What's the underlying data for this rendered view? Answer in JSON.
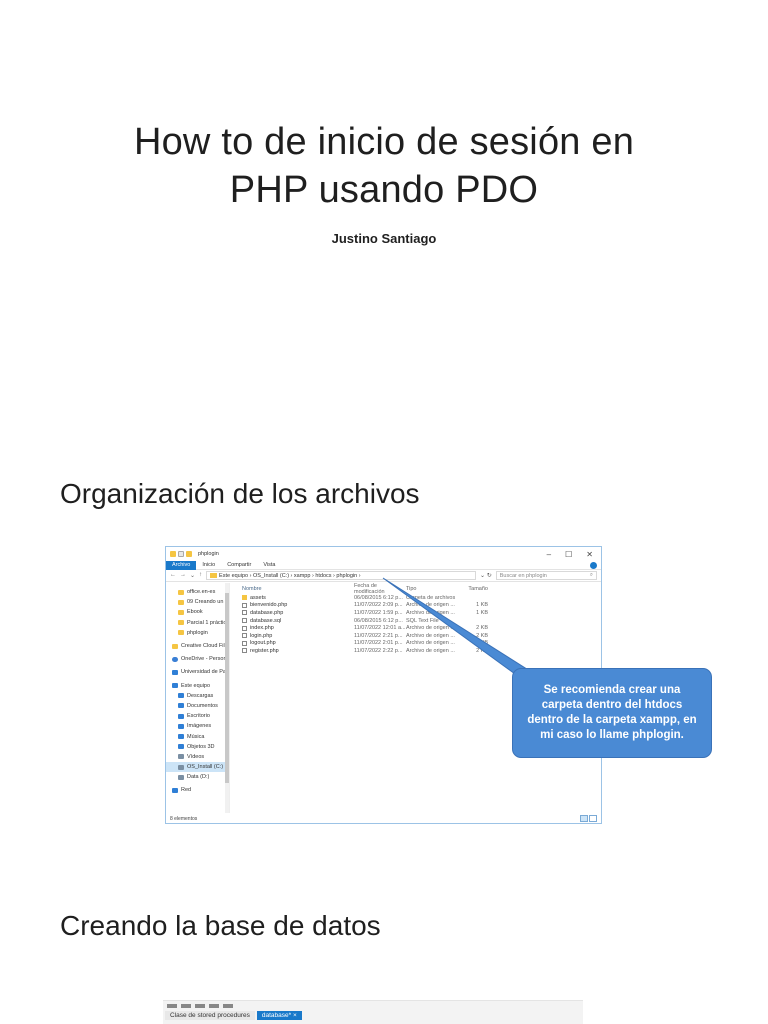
{
  "slide": {
    "title_line1": "How to de inicio de sesión en",
    "title_line2": "PHP usando PDO",
    "author": "Justino Santiago",
    "section1": "Organización de los archivos",
    "section2": "Creando la base de datos"
  },
  "explorer": {
    "window_title": "phplogin",
    "window_controls": [
      "–",
      "☐",
      "✕"
    ],
    "ribbon_tabs": [
      "Archivo",
      "Inicio",
      "Compartir",
      "Vista"
    ],
    "nav_arrows": [
      "←",
      "→",
      "⌄",
      "↑"
    ],
    "breadcrumb": "Este equipo  ›  OS_Install (C:)  ›  xampp  ›  htdocs  ›  phplogin  ›",
    "search_placeholder": "Buscar en phplogin",
    "columns": [
      "Nombre",
      "Fecha de modificación",
      "Tipo",
      "Tamaño"
    ],
    "nav_items": [
      {
        "label": "office.en-es",
        "icon": "folder",
        "indent": true
      },
      {
        "label": "09 Creando un lo",
        "icon": "folder",
        "indent": true
      },
      {
        "label": "Ebook",
        "icon": "folder",
        "indent": true
      },
      {
        "label": "Parcial 1 práctico",
        "icon": "folder",
        "indent": true
      },
      {
        "label": "phplogin",
        "icon": "folder",
        "indent": true
      },
      {
        "label": "Creative Cloud Fil",
        "icon": "folder",
        "indent": false,
        "gap": true
      },
      {
        "label": "OneDrive - Person",
        "icon": "cloud",
        "indent": false,
        "gap": true
      },
      {
        "label": "Universidad de Pa",
        "icon": "blue",
        "indent": false,
        "gap": true
      },
      {
        "label": "Este equipo",
        "icon": "blue",
        "indent": false,
        "gap": true
      },
      {
        "label": "Descargas",
        "icon": "down",
        "indent": true
      },
      {
        "label": "Documentos",
        "icon": "blue",
        "indent": true
      },
      {
        "label": "Escritorio",
        "icon": "blue",
        "indent": true
      },
      {
        "label": "Imágenes",
        "icon": "blue",
        "indent": true
      },
      {
        "label": "Música",
        "icon": "blue",
        "indent": true
      },
      {
        "label": "Objetos 3D",
        "icon": "blue",
        "indent": true
      },
      {
        "label": "Vídeos",
        "icon": "drive",
        "indent": true
      },
      {
        "label": "OS_Install (C:)",
        "icon": "drive",
        "indent": true,
        "selected": true
      },
      {
        "label": "Data (D:)",
        "icon": "drive",
        "indent": true
      },
      {
        "label": "Red",
        "icon": "blue",
        "indent": false,
        "gap": true
      }
    ],
    "files": [
      {
        "name": "assets",
        "date": "06/08/2015 6:12 p...",
        "type": "Carpeta de archivos",
        "size": "",
        "icon": "folder"
      },
      {
        "name": "bienvenido.php",
        "date": "11/07/2022 2:09 p...",
        "type": "Archivo de origen ...",
        "size": "1 KB",
        "icon": "file"
      },
      {
        "name": "database.php",
        "date": "11/07/2022 1:59 p...",
        "type": "Archivo de origen ...",
        "size": "1 KB",
        "icon": "file"
      },
      {
        "name": "database.sql",
        "date": "06/08/2015 6:12 p...",
        "type": "SQL Text File",
        "size": "",
        "icon": "file"
      },
      {
        "name": "index.php",
        "date": "11/07/2022 12:01 a...",
        "type": "Archivo de origen ...",
        "size": "2 KB",
        "icon": "file"
      },
      {
        "name": "login.php",
        "date": "11/07/2022 2:21 p...",
        "type": "Archivo de origen ...",
        "size": "2 KB",
        "icon": "file"
      },
      {
        "name": "logout.php",
        "date": "11/07/2022 2:01 p...",
        "type": "Archivo de origen ...",
        "size": "1 KB",
        "icon": "file"
      },
      {
        "name": "register.php",
        "date": "11/07/2022 2:22 p...",
        "type": "Archivo de origen ...",
        "size": "2 KB",
        "icon": "file"
      }
    ],
    "status": "8 elementos"
  },
  "callout": {
    "text": "Se recomienda crear una carpeta dentro del htdocs dentro de la carpeta xampp, en mi caso lo llame phplogin."
  },
  "db_screenshot": {
    "tabs": [
      "Clase de stored procedures",
      "database* ×"
    ]
  },
  "colors": {
    "accent": "#1979ca",
    "callout_fill": "#4a8ad4",
    "folder": "#f5c542"
  }
}
